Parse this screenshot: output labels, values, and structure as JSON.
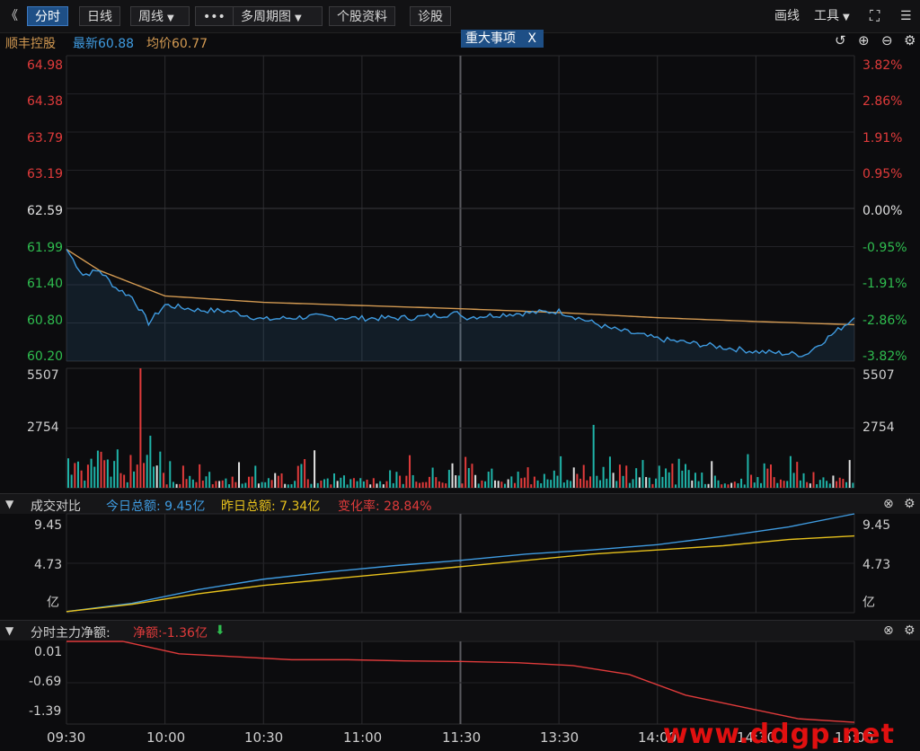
{
  "toolbar": {
    "back_glyph": "《",
    "tabs": [
      "分时",
      "日线",
      "周线",
      "•••",
      "多周期图",
      "个股资料",
      "诊股"
    ],
    "draw_label": "画线",
    "tools_label": "工具"
  },
  "stock": {
    "name": "顺丰控股",
    "latest": "最新60.88",
    "avg": "均价60.77",
    "event_tag": "重大事项",
    "event_close": "X"
  },
  "price_axis": {
    "left": [
      "64.98",
      "64.38",
      "63.79",
      "63.19",
      "62.59",
      "61.99",
      "61.40",
      "60.80",
      "60.20"
    ],
    "right": [
      "3.82%",
      "2.86%",
      "1.91%",
      "0.95%",
      "0.00%",
      "-0.95%",
      "-1.91%",
      "-2.86%",
      "-3.82%"
    ]
  },
  "volume_axis": {
    "labels": [
      "5507",
      "2754"
    ]
  },
  "compare_panel": {
    "title": "成交对比",
    "today": "今日总额: 9.45亿",
    "yesterday": "昨日总额: 7.34亿",
    "change": "变化率: 28.84%",
    "y_labels": [
      "9.45",
      "4.73",
      "亿"
    ]
  },
  "netflow_panel": {
    "title": "分时主力净额:",
    "value": "净额:-1.36亿",
    "arrow": "⬇",
    "y_labels": [
      "0.01",
      "-0.69",
      "-1.39"
    ]
  },
  "x_axis": [
    "09:30",
    "10:00",
    "10:30",
    "11:00",
    "11:30",
    "13:30",
    "14:00",
    "14:30",
    "15:00"
  ],
  "watermark": "www.ddgp.net",
  "colors": {
    "up": "#e03b3b",
    "down": "#2fbd4f",
    "price": "#3f9be0",
    "avg": "#d39a52",
    "teal": "#1fb3a8",
    "red": "#e03b3b",
    "yellow": "#e8c21c"
  },
  "chart_data": [
    {
      "type": "line",
      "title": "",
      "series": [
        {
          "x": [
            "09:30",
            "09:35",
            "09:40",
            "09:45",
            "09:50",
            "09:55",
            "10:00",
            "10:10",
            "10:20",
            "10:30",
            "10:45",
            "11:00",
            "11:15",
            "11:30",
            "13:00",
            "13:15",
            "13:30",
            "13:45",
            "14:00",
            "14:15",
            "14:30",
            "14:45",
            "15:00"
          ],
          "values": [
            61.95,
            61.55,
            61.62,
            61.35,
            61.2,
            60.8,
            61.08,
            61.0,
            60.98,
            60.85,
            60.9,
            60.87,
            60.88,
            60.95,
            60.88,
            60.94,
            60.98,
            60.72,
            60.55,
            60.45,
            60.35,
            60.3,
            60.88
          ]
        },
        {
          "x": [
            "09:30",
            "09:40",
            "09:50",
            "10:00",
            "10:30",
            "11:00",
            "11:30",
            "13:30",
            "14:00",
            "14:30",
            "15:00"
          ],
          "values": [
            61.95,
            61.62,
            61.42,
            61.22,
            61.12,
            61.07,
            61.02,
            60.96,
            60.88,
            60.82,
            60.77
          ]
        }
      ],
      "ylim": [
        60.2,
        64.98
      ],
      "pct_range": [
        -3.82,
        3.82
      ]
    },
    {
      "type": "bar",
      "ylim": [
        0,
        5507
      ],
      "peaks": [
        {
          "x": "09:52",
          "value": 5507
        },
        {
          "x": "13:40",
          "value": 2900
        },
        {
          "x": "09:55",
          "value": 2400
        }
      ]
    },
    {
      "type": "line",
      "series": [
        {
          "values": [
            0.1,
            0.9,
            2.2,
            3.2,
            3.9,
            4.5,
            5.0,
            5.6,
            6.0,
            6.5,
            7.3,
            8.2,
            9.45
          ]
        },
        {
          "values": [
            0.1,
            0.8,
            1.8,
            2.6,
            3.2,
            3.8,
            4.4,
            5.0,
            5.6,
            6.0,
            6.4,
            7.0,
            7.34
          ]
        }
      ],
      "ylim": [
        0,
        9.45
      ]
    },
    {
      "type": "line",
      "series": [
        {
          "values": [
            0.01,
            0.01,
            -0.2,
            -0.25,
            -0.3,
            -0.3,
            -0.32,
            -0.33,
            -0.35,
            -0.4,
            -0.55,
            -0.9,
            -1.1,
            -1.3,
            -1.36
          ]
        }
      ],
      "ylim": [
        -1.39,
        0.01
      ]
    }
  ]
}
